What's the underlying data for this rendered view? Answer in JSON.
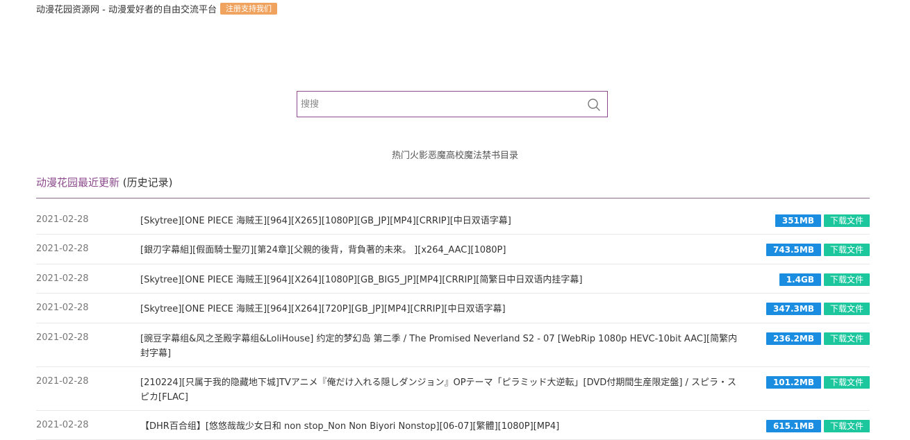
{
  "header": {
    "site_title": "动漫花园资源网 - 动漫爱好者的自由交流平台",
    "register_label": "注册支持我们"
  },
  "search": {
    "placeholder": "搜搜",
    "value": ""
  },
  "hot": {
    "links": [
      "热门",
      "火影",
      "恶魔高校",
      "魔法禁书目录"
    ]
  },
  "section": {
    "title": "动漫花园最近更新",
    "history_label": "(历史记录)"
  },
  "download_label": "下载文件",
  "colors": {
    "accent": "#8c4a8c",
    "register_badge": "#f0a35e",
    "size_badge": "#1a8de0",
    "download_button": "#1cc79e"
  },
  "items": [
    {
      "date": "2021-02-28",
      "title": "[Skytree][ONE PIECE 海贼王][964][X265][1080P][GB_JP][MP4][CRRIP][中日双语字幕]",
      "size": "351MB"
    },
    {
      "date": "2021-02-28",
      "title": "[銀刃字幕組][假面騎士聖刃][第24章][父親的後背，背負著的未來。 ][x264_AAC][1080P]",
      "size": "743.5MB"
    },
    {
      "date": "2021-02-28",
      "title": "[Skytree][ONE PIECE 海贼王][964][X264][1080P][GB_BIG5_JP][MP4][CRRIP][简繁日中日双语内挂字幕]",
      "size": "1.4GB"
    },
    {
      "date": "2021-02-28",
      "title": "[Skytree][ONE PIECE 海贼王][964][X264][720P][GB_JP][MP4][CRRIP][中日双语字幕]",
      "size": "347.3MB"
    },
    {
      "date": "2021-02-28",
      "title": "[豌豆字幕组&风之圣殿字幕组&LoliHouse] 约定的梦幻岛 第二季 / The Promised Neverland S2 - 07 [WebRip 1080p HEVC-10bit AAC][简繁内封字幕]",
      "size": "236.2MB"
    },
    {
      "date": "2021-02-28",
      "title": "[210224][只属于我的隐藏地下城]TVアニメ『俺だけ入れる隠しダンジョン』OPテーマ「ピラミッド大逆転」[DVD付期間生産限定盤] / スピラ・スピカ[FLAC]",
      "size": "101.2MB"
    },
    {
      "date": "2021-02-28",
      "title": "【DHR百合组】[悠悠哉哉少女日和 non stop_Non Non Biyori Nonstop][06-07][繁體][1080P][MP4]",
      "size": "615.1MB"
    }
  ]
}
